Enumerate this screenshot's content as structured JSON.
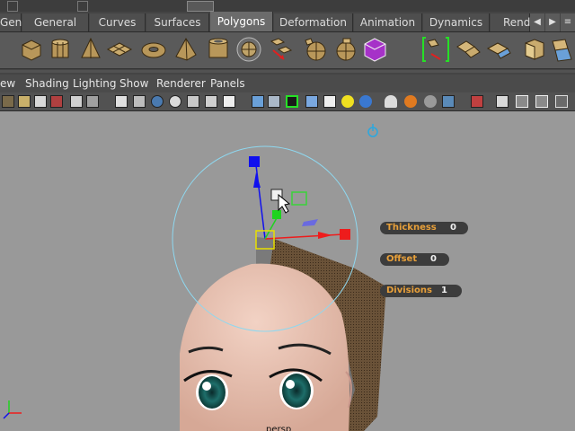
{
  "shelf_tabs": [
    {
      "label": "Gen",
      "active": false
    },
    {
      "label": "General",
      "active": false
    },
    {
      "label": "Curves",
      "active": false
    },
    {
      "label": "Surfaces",
      "active": false
    },
    {
      "label": "Polygons",
      "active": true
    },
    {
      "label": "Deformation",
      "active": false
    },
    {
      "label": "Animation",
      "active": false
    },
    {
      "label": "Dynamics",
      "active": false
    },
    {
      "label": "Rend",
      "active": false
    }
  ],
  "tab_scroll": {
    "left": "◀",
    "right": "▶",
    "menu": "≡"
  },
  "shelf_icons": [
    "poly-cube-icon",
    "poly-cylinder-icon",
    "poly-cone-icon",
    "poly-plane-icon",
    "poly-torus-icon",
    "poly-pyramid-icon",
    "poly-pipe-icon",
    "separate-icon",
    "combine-icon",
    "extract-icon",
    "smooth-icon",
    "boolean-icon",
    "bridge-icon",
    "append-polygon-icon",
    "paint-texture-icon",
    "extrude-face-icon",
    "split-polygon-icon",
    "keep-faces-icon",
    "wedge-icon"
  ],
  "panel_menu": [
    "ew",
    "Shading",
    "Lighting",
    "Show",
    "Renderer",
    "Panels"
  ],
  "panel_tools": [
    "select-camera-icon",
    "camera-attributes-icon",
    "bookmark-icon",
    "image-plane-icon",
    "grid-icon",
    "film-gate-icon",
    "resolution-gate-icon",
    "gate-mask-icon",
    "field-chart-icon",
    "safe-action-icon",
    "safe-title-icon",
    "wireframe-icon",
    "smooth-shade-icon",
    "wireframe-on-shaded-icon",
    "default-material-icon",
    "xray-icon",
    "use-lights-icon",
    "shadows-icon",
    "texture-icon",
    "high-quality-icon",
    "isolate-icon",
    "xray-joints-icon",
    "select-highlight-icon",
    "frame-all-icon",
    "frame-selected-icon",
    "tear-off-icon"
  ],
  "tool_attributes": [
    {
      "label": "Thickness",
      "value": "0"
    },
    {
      "label": "Offset",
      "value": "0"
    },
    {
      "label": "Divisions",
      "value": "1"
    }
  ],
  "camera_label": "persp",
  "colors": {
    "manip_x": "#ee1c1c",
    "manip_y": "#1fd31f",
    "manip_z": "#1010ee",
    "manip_ring": "#8ed8f0",
    "attr_label": "#e8a03a"
  }
}
